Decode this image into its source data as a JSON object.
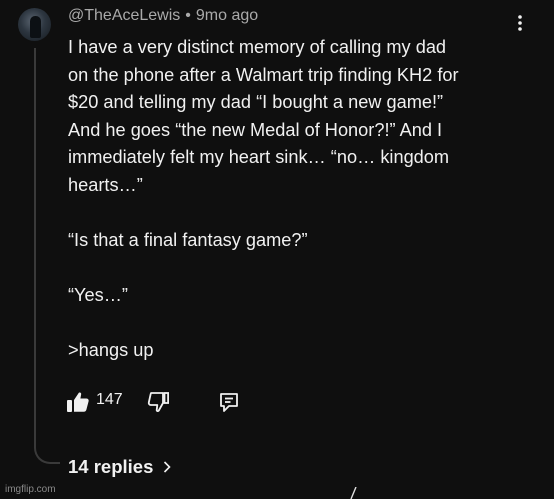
{
  "comment": {
    "author": "@TheAceLewis",
    "separator": "•",
    "timestamp": "9mo ago",
    "lines": [
      "I have a very distinct memory of calling my dad",
      "on the phone after a Walmart trip finding KH2 for",
      "$20 and telling my dad “I bought a new game!”",
      "And he goes “the new Medal of Honor?!” And I",
      "immediately felt my heart sink… “no… kingdom",
      "hearts…”",
      "",
      "“Is that a final fantasy game?”",
      "",
      "“Yes…”",
      "",
      ">hangs up"
    ]
  },
  "actions": {
    "like_icon": "thumbs-up-filled-icon",
    "like_count": "147",
    "dislike_icon": "thumbs-down-outline-icon",
    "reply_icon": "reply-comment-icon",
    "more_icon": "more-vertical-icon"
  },
  "replies": {
    "label": "14 replies",
    "icon": "chevron-right-icon"
  },
  "watermark": {
    "text": "imgflip.com"
  },
  "colors": {
    "background": "#0f0f0f",
    "text_primary": "#f1f1f1",
    "text_secondary": "#aaaaaa",
    "thread_line": "#3a3a3a"
  }
}
